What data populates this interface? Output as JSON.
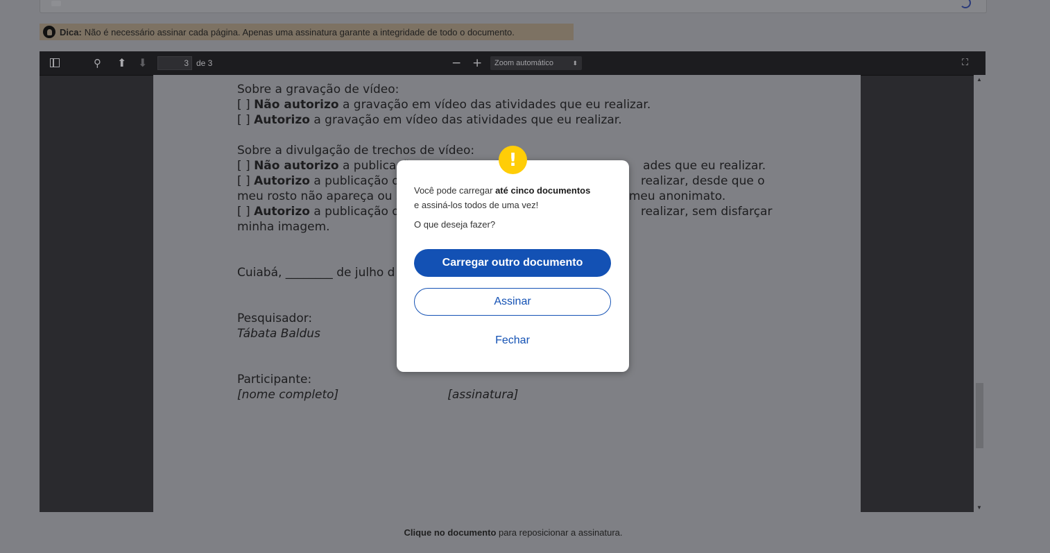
{
  "tip": {
    "label": "Dica:",
    "text": "Não é necessário assinar cada página. Apenas uma assinatura garante a integridade de todo o documento."
  },
  "toolbar": {
    "page_current": "3",
    "page_of": "de 3",
    "zoom_minus": "−",
    "zoom_plus": "+",
    "zoom_value": "Zoom automático"
  },
  "document": {
    "video_recording_heading": "Sobre a gravação de vídeo:",
    "rec_opt1_bold": "Não autorizo",
    "rec_opt1_rest": " a gravação em vídeo das atividades que eu realizar.",
    "rec_opt2_bold": "Autorizo",
    "rec_opt2_rest": " a gravação em vídeo das atividades que eu realizar.",
    "video_share_heading": "Sobre a divulgação de trechos de vídeo:",
    "share_opt1_bold": "Não autorizo",
    "share_opt1_rest": " a publicaçã",
    "share_opt1_tail": "ades que eu realizar.",
    "share_opt2_bold": "Autorizo",
    "share_opt2_rest": " a publicação de",
    "share_opt2_tail": " realizar, desde que o",
    "share_opt2_line2": "meu rosto não apareça ou s",
    "share_opt2_line2_tail": "meu anonimato.",
    "share_opt3_bold": "Autorizo",
    "share_opt3_rest": " a publicação de",
    "share_opt3_tail": " realizar, sem disfarçar",
    "share_opt3_line2": "minha imagem.",
    "date_line": "Cuiabá, ________ de julho d",
    "researcher_label": "Pesquisador:",
    "researcher_name": "Tábata Baldus",
    "participant_label": "Participante:",
    "participant_name": "[nome completo]",
    "participant_signature": "[assinatura]"
  },
  "footer": {
    "bold": "Clique no documento",
    "rest": " para reposicionar a assinatura."
  },
  "modal": {
    "icon": "!",
    "msg_pre": "Você pode carregar ",
    "msg_bold": "até cinco documentos",
    "msg_post": "e assiná-los todos de uma vez!",
    "question": "O que deseja fazer?",
    "primary_button": "Carregar outro documento",
    "secondary_button": "Assinar",
    "link_button": "Fechar"
  },
  "colors": {
    "primary": "#1351b4",
    "alert": "#ffcd07"
  }
}
